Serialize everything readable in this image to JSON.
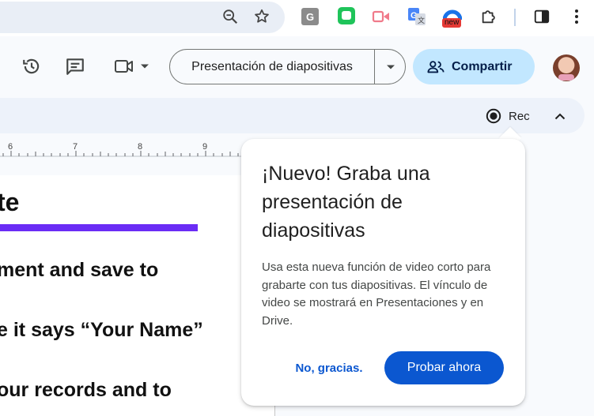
{
  "browser": {
    "icons": [
      "zoom-out-icon",
      "bookmark-star-icon",
      "extension-g-icon",
      "extension-face-icon",
      "extension-video-icon",
      "translate-icon",
      "extension-new-icon",
      "extensions-puzzle-icon",
      "side-panel-icon",
      "more-vert-icon"
    ],
    "extension_g_letter": "G",
    "new_badge": "new"
  },
  "toolbar": {
    "slideshow_label": "Presentación de diapositivas",
    "share_label": "Compartir",
    "icons": [
      "history-icon",
      "comment-icon",
      "meet-camera-icon",
      "chevron-down-icon",
      "people-icon",
      "avatar"
    ]
  },
  "subbar": {
    "rec_label": "Rec"
  },
  "ruler": {
    "numbers": [
      "6",
      "7",
      "8",
      "9"
    ]
  },
  "document": {
    "title_fragment": "te",
    "lines": [
      "ment and save to",
      "e it says “Your Name”",
      "our records and to"
    ]
  },
  "popup": {
    "title": "¡Nuevo! Graba una presentación de diapositivas",
    "body": "Usa esta nueva función de video corto para grabarte con tus diapositivas. El vínculo de video se mostrará en Presentaciones y en Drive.",
    "dismiss_label": "No, gracias.",
    "try_label": "Probar ahora"
  },
  "colors": {
    "accent_blue": "#0b57d0",
    "share_bg": "#c2e7ff",
    "underline_purple": "#6a2cf5",
    "new_badge_red": "#e53935"
  }
}
